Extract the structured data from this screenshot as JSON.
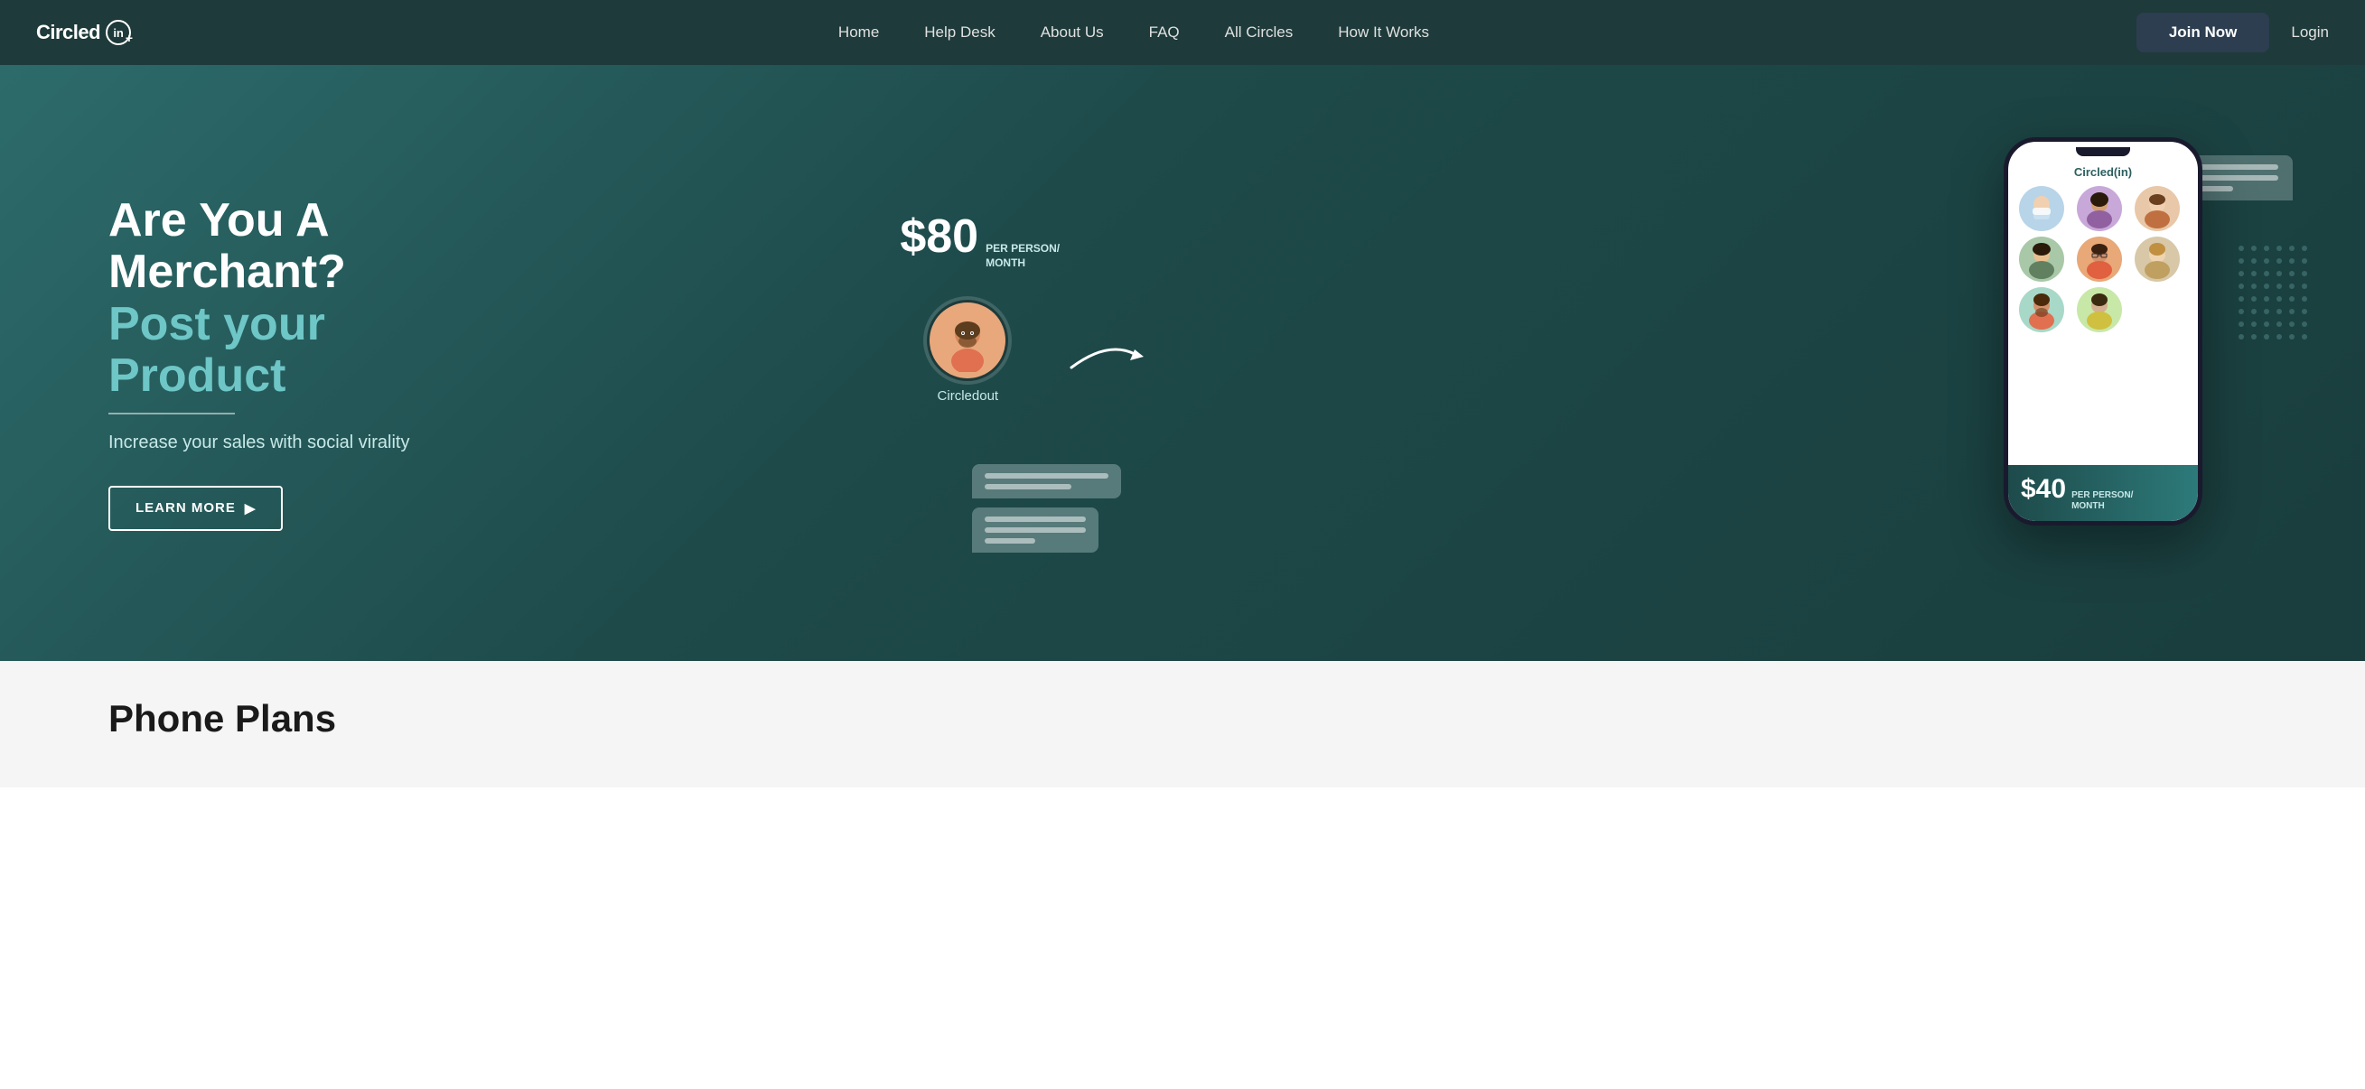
{
  "navbar": {
    "logo_text": "Circled",
    "logo_icon": "in",
    "nav_links": [
      {
        "label": "Home",
        "id": "home"
      },
      {
        "label": "Help Desk",
        "id": "help-desk"
      },
      {
        "label": "About Us",
        "id": "about-us"
      },
      {
        "label": "FAQ",
        "id": "faq"
      },
      {
        "label": "All Circles",
        "id": "all-circles"
      },
      {
        "label": "How It Works",
        "id": "how-it-works"
      }
    ],
    "join_now_label": "Join Now",
    "login_label": "Login"
  },
  "hero": {
    "title_line1": "Are You A Merchant?",
    "title_line2": "Post your Product",
    "description": "Increase your sales with social virality",
    "learn_more_label": "LEARN MORE",
    "pricing_amount": "$80",
    "pricing_label_line1": "PER PERSON/",
    "pricing_label_line2": "MONTH",
    "avatar_label": "Circledout",
    "phone_logo": "Circled(in)",
    "phone_price_amount": "$40",
    "phone_price_label_line1": "PER PERSON/",
    "phone_price_label_line2": "MONTH"
  },
  "bottom": {
    "phone_plans_title": "Phone Plans"
  },
  "colors": {
    "hero_bg_start": "#2d6b6b",
    "hero_bg_end": "#1a3d3d",
    "navbar_bg": "#1e3a3a",
    "join_btn_bg": "#2c3e50",
    "accent_teal": "#6ec6c6"
  },
  "phone_avatars": [
    {
      "color": "#b8d4e8",
      "emoji": "😷"
    },
    {
      "color": "#c8a8d8",
      "emoji": "👩"
    },
    {
      "color": "#e8c8a8",
      "emoji": "👩‍🦱"
    },
    {
      "color": "#a8c8a8",
      "emoji": "👩‍🦳"
    },
    {
      "color": "#e8a878",
      "emoji": "👨"
    },
    {
      "color": "#d8c8a8",
      "emoji": "👩‍🦰"
    },
    {
      "color": "#a8d8c8",
      "emoji": "🧔"
    },
    {
      "color": "#c8e8a8",
      "emoji": "🧑"
    }
  ]
}
